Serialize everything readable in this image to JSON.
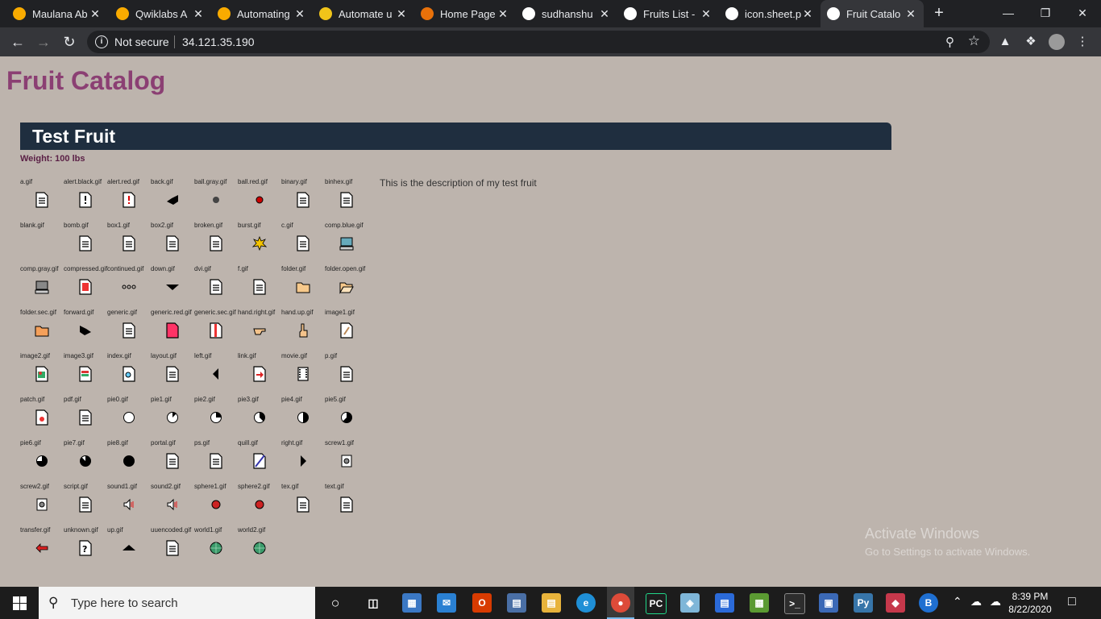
{
  "browser": {
    "tabs": [
      {
        "title": "Maulana Ab",
        "icon": "colab-icon",
        "color": "#f9ab00"
      },
      {
        "title": "Qwiklabs A",
        "icon": "colab-icon",
        "color": "#f9ab00"
      },
      {
        "title": "Automating",
        "icon": "colab-icon",
        "color": "#f9ab00"
      },
      {
        "title": "Automate u",
        "icon": "coursera-icon",
        "color": "#f0c419"
      },
      {
        "title": "Home Page",
        "icon": "loading-icon",
        "color": "#e8710a"
      },
      {
        "title": "sudhanshu",
        "icon": "google-icon",
        "color": "#ffffff"
      },
      {
        "title": "Fruits List -",
        "icon": "globe-icon",
        "color": "#ffffff"
      },
      {
        "title": "icon.sheet.p",
        "icon": "globe-icon",
        "color": "#ffffff"
      },
      {
        "title": "Fruit Catalo",
        "icon": "globe-icon",
        "color": "#ffffff",
        "active": true
      }
    ],
    "security_label": "Not secure",
    "url": "34.121.35.190"
  },
  "page": {
    "title": "Fruit Catalog",
    "fruit_name": "Test Fruit",
    "weight": "Weight: 100 lbs",
    "description": "This is the description of my test fruit",
    "icons": [
      "a.gif",
      "alert.black.gif",
      "alert.red.gif",
      "back.gif",
      "ball.gray.gif",
      "ball.red.gif",
      "binary.gif",
      "binhex.gif",
      "blank.gif",
      "bomb.gif",
      "box1.gif",
      "box2.gif",
      "broken.gif",
      "burst.gif",
      "c.gif",
      "comp.blue.gif",
      "comp.gray.gif",
      "compressed.gif",
      "continued.gif",
      "down.gif",
      "dvi.gif",
      "f.gif",
      "folder.gif",
      "folder.open.gif",
      "folder.sec.gif",
      "forward.gif",
      "generic.gif",
      "generic.red.gif",
      "generic.sec.gif",
      "hand.right.gif",
      "hand.up.gif",
      "image1.gif",
      "image2.gif",
      "image3.gif",
      "index.gif",
      "layout.gif",
      "left.gif",
      "link.gif",
      "movie.gif",
      "p.gif",
      "patch.gif",
      "pdf.gif",
      "pie0.gif",
      "pie1.gif",
      "pie2.gif",
      "pie3.gif",
      "pie4.gif",
      "pie5.gif",
      "pie6.gif",
      "pie7.gif",
      "pie8.gif",
      "portal.gif",
      "ps.gif",
      "quill.gif",
      "right.gif",
      "screw1.gif",
      "screw2.gif",
      "script.gif",
      "sound1.gif",
      "sound2.gif",
      "sphere1.gif",
      "sphere2.gif",
      "tex.gif",
      "text.gif",
      "transfer.gif",
      "unknown.gif",
      "up.gif",
      "uuencoded.gif",
      "world1.gif",
      "world2.gif"
    ]
  },
  "watermark": {
    "line1": "Activate Windows",
    "line2": "Go to Settings to activate Windows."
  },
  "taskbar": {
    "search_placeholder": "Type here to search",
    "time": "8:39 PM",
    "date": "8/22/2020"
  },
  "colors": {
    "page_bg": "#bdb4ad",
    "title": "#8b3f73",
    "header_bg": "#1f2e3f",
    "weight_text": "#5a1f45"
  }
}
